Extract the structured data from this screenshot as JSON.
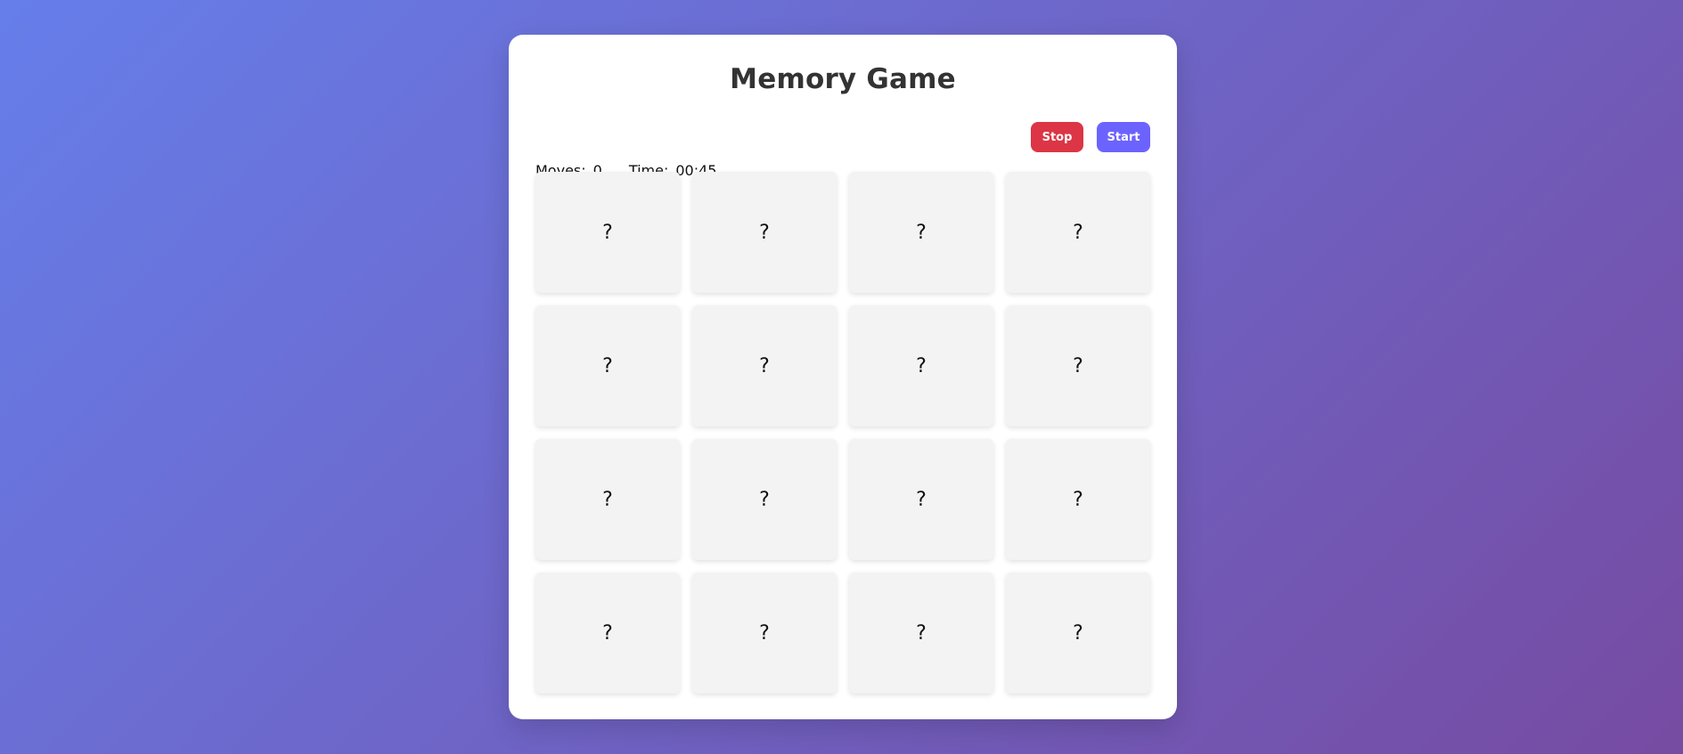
{
  "game": {
    "title": "Memory Game"
  },
  "stats": {
    "moves_label": "Moves:",
    "moves_value": "0",
    "time_label": "Time:",
    "time_value": "00:45"
  },
  "controls": {
    "stop_label": "Stop",
    "start_label": "Start"
  },
  "colors": {
    "background_start": "#667eea",
    "background_end": "#764ba2",
    "stop_button": "#dc3545",
    "start_button": "#6c63ff",
    "card_face_down": "#f3f3f3",
    "title": "#333333"
  },
  "cards": [
    {
      "face": "?"
    },
    {
      "face": "?"
    },
    {
      "face": "?"
    },
    {
      "face": "?"
    },
    {
      "face": "?"
    },
    {
      "face": "?"
    },
    {
      "face": "?"
    },
    {
      "face": "?"
    },
    {
      "face": "?"
    },
    {
      "face": "?"
    },
    {
      "face": "?"
    },
    {
      "face": "?"
    },
    {
      "face": "?"
    },
    {
      "face": "?"
    },
    {
      "face": "?"
    },
    {
      "face": "?"
    }
  ]
}
